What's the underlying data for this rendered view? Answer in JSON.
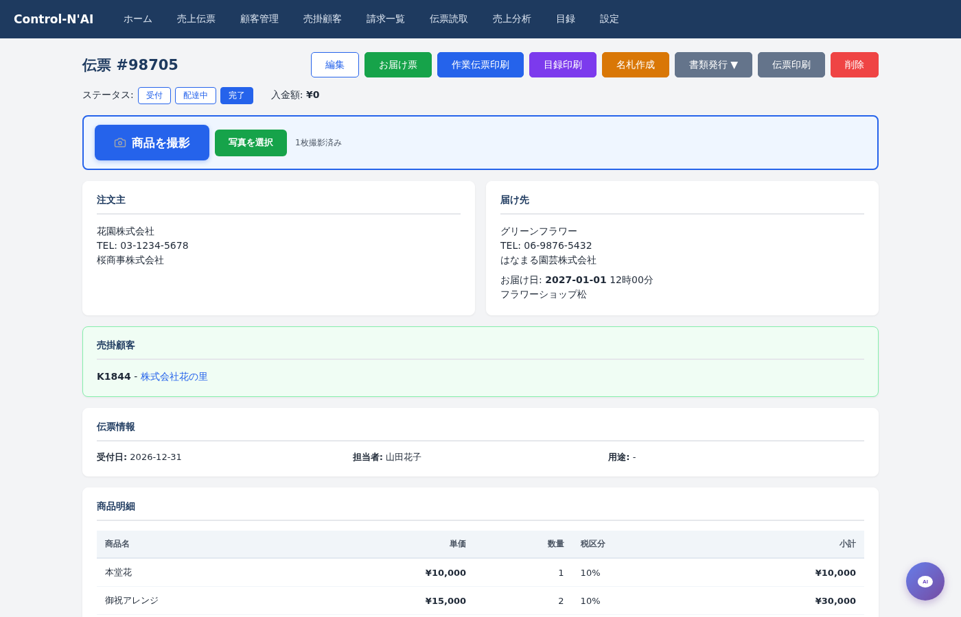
{
  "nav": {
    "brand": "Control-N'AI",
    "items": [
      "ホーム",
      "売上伝票",
      "顧客管理",
      "売掛顧客",
      "請求一覧",
      "伝票読取",
      "売上分析",
      "目録",
      "設定"
    ]
  },
  "header": {
    "title": "伝票 #98705",
    "buttons": [
      {
        "label": "編集",
        "kind": "outline"
      },
      {
        "label": "お届け票",
        "kind": "green"
      },
      {
        "label": "作業伝票印刷",
        "kind": "blue"
      },
      {
        "label": "目録印刷",
        "kind": "purple"
      },
      {
        "label": "名札作成",
        "kind": "orange"
      },
      {
        "label": "書類発行 ▼",
        "kind": "gray"
      },
      {
        "label": "伝票印刷",
        "kind": "gray"
      },
      {
        "label": "削除",
        "kind": "red"
      }
    ]
  },
  "status": {
    "label": "ステータス:",
    "options": [
      {
        "label": "受付",
        "selected": false
      },
      {
        "label": "配達中",
        "selected": false
      },
      {
        "label": "完了",
        "selected": true
      }
    ],
    "payment_label": "入金額:",
    "payment_value": "¥0"
  },
  "photo": {
    "capture_button": "商品を撮影",
    "select_button": "写真を選択",
    "note": "1枚撮影済み"
  },
  "orderer": {
    "title": "注文主",
    "lines": [
      "花園株式会社",
      "TEL: 03-1234-5678",
      "桜商事株式会社"
    ]
  },
  "delivery": {
    "title": "届け先",
    "lines": [
      "グリーンフラワー",
      "TEL: 06-9876-5432",
      "はなまる園芸株式会社"
    ],
    "extra": [
      "お届け日: **2027-01-01** 12時00分",
      "フラワーショップ松"
    ]
  },
  "receivable": {
    "title": "売掛顧客",
    "code": "K1844",
    "separator": " - ",
    "name": "株式会社花の里"
  },
  "slip_info": {
    "title": "伝票情報",
    "fields": [
      {
        "label": "受付日:",
        "value": "2026-12-31"
      },
      {
        "label": "担当者:",
        "value": "山田花子"
      },
      {
        "label": "用途:",
        "value": "-"
      }
    ]
  },
  "items": {
    "title": "商品明細",
    "columns": [
      "商品名",
      "単価",
      "数量",
      "税区分",
      "小計"
    ],
    "rows": [
      [
        "本堂花",
        "¥10,000",
        "1",
        "10%",
        "¥10,000"
      ],
      [
        "御祝アレンジ",
        "¥15,000",
        "2",
        "10%",
        "¥30,000"
      ]
    ]
  },
  "chat_button": {
    "label": "AI"
  }
}
